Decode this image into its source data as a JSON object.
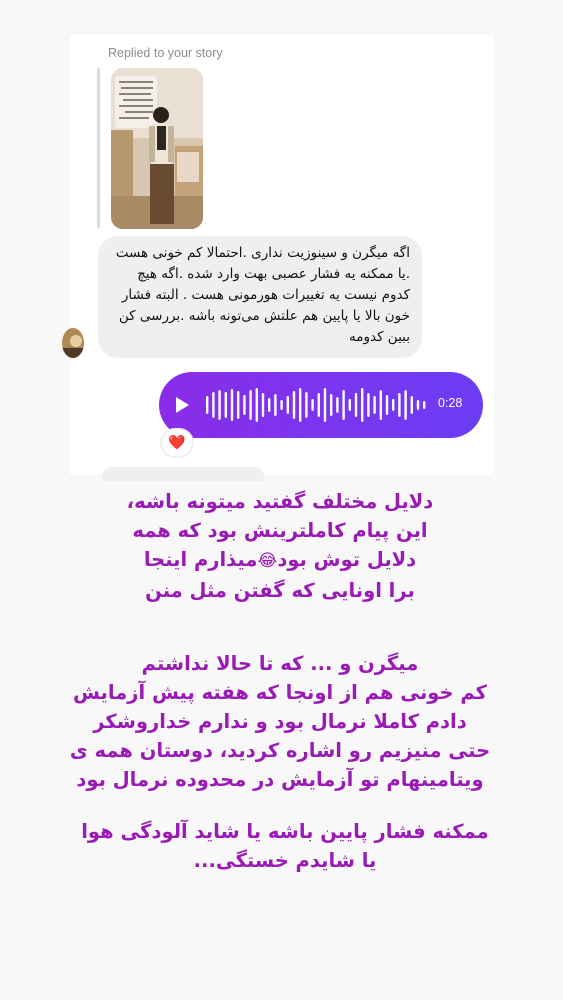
{
  "reply_context": {
    "label": "Replied to your story"
  },
  "incoming_message": {
    "text": "اگه میگرن و سینوزیت نداری .احتمالا کم خونی هست .یا ممکنه یه فشار عصبی بهت وارد شده .اگه هیچ کدوم نیست یه تغییرات هورمونی هست . البته فشار خون بالا یا پایین هم علتش می‌تونه باشه .بررسی کن ببین کدومه"
  },
  "voice_message": {
    "duration": "0:28",
    "icon": "play-icon",
    "color": "#7a35f0"
  },
  "reaction": {
    "emoji": "❤️"
  },
  "captions": {
    "paragraph_1_lines": [
      "دلایل مختلف گفتید میتونه باشه،",
      "این پیام کاملترینش بود که همه",
      "دلایل توش بود",
      "میذارم اینجا",
      "برا اونایی که گفتن مثل منن"
    ],
    "paragraph_1_emoji": "😂",
    "paragraph_2_lines": [
      "میگرن و ... که تا حالا نداشتم",
      "کم خونی هم از اونجا که هفته پیش آزمایش",
      "دادم کاملا نرمال بود و ندارم خداروشکر",
      "حتی منیزیم رو اشاره کردید، دوستان همه ی",
      "ویتامینهام تو آزمایش در محدوده نرمال بود"
    ],
    "paragraph_3_lines": [
      "ممکنه فشار پایین باشه یا شاید آلودگی هوا",
      "یا شایدم خستگی..."
    ],
    "color": "#9a1ab5"
  }
}
